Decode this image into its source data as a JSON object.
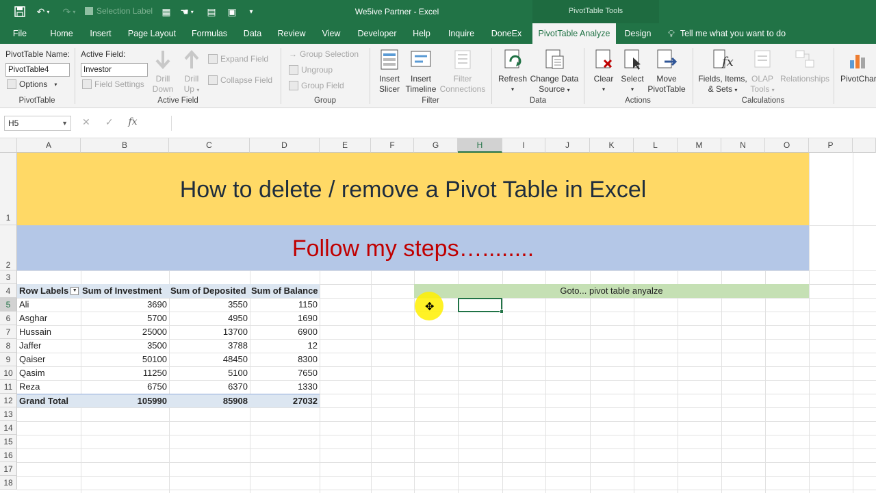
{
  "titlebar": {
    "selection_label": "Selection Label",
    "doc_title": "We5ive Partner  -  Excel",
    "tools_header": "PivotTable Tools"
  },
  "tabs": [
    {
      "label": "File",
      "active": false
    },
    {
      "label": "Home",
      "active": false
    },
    {
      "label": "Insert",
      "active": false
    },
    {
      "label": "Page Layout",
      "active": false
    },
    {
      "label": "Formulas",
      "active": false
    },
    {
      "label": "Data",
      "active": false
    },
    {
      "label": "Review",
      "active": false
    },
    {
      "label": "View",
      "active": false
    },
    {
      "label": "Developer",
      "active": false
    },
    {
      "label": "Help",
      "active": false
    },
    {
      "label": "Inquire",
      "active": false
    },
    {
      "label": "DoneEx",
      "active": false
    },
    {
      "label": "PivotTable Analyze",
      "active": true
    },
    {
      "label": "Design",
      "active": false
    }
  ],
  "tell_me": "Tell me what you want to do",
  "ribbon": {
    "pivottable": {
      "name_label": "PivotTable Name:",
      "name_value": "PivotTable4",
      "options": "Options",
      "group": "PivotTable"
    },
    "active_field": {
      "label": "Active Field:",
      "value": "Investor",
      "field_settings": "Field Settings",
      "drill_down": [
        "Drill",
        "Down"
      ],
      "drill_up": [
        "Drill",
        "Up"
      ],
      "expand_field": "Expand Field",
      "collapse_field": "Collapse Field",
      "group": "Active Field"
    },
    "group": {
      "group_selection": "Group Selection",
      "ungroup": "Ungroup",
      "group_field": "Group Field",
      "group": "Group"
    },
    "filter": {
      "insert_slicer": [
        "Insert",
        "Slicer"
      ],
      "insert_timeline": [
        "Insert",
        "Timeline"
      ],
      "filter_connections": [
        "Filter",
        "Connections"
      ],
      "group": "Filter"
    },
    "data": {
      "refresh": "Refresh",
      "change_data_source": [
        "Change Data",
        "Source"
      ],
      "group": "Data"
    },
    "actions": {
      "clear": "Clear",
      "select": "Select",
      "move_pivottable": [
        "Move",
        "PivotTable"
      ],
      "group": "Actions"
    },
    "calculations": {
      "fields_items_sets": [
        "Fields, Items,",
        "& Sets"
      ],
      "olap_tools": [
        "OLAP",
        "Tools"
      ],
      "relationships": "Relationships",
      "group": "Calculations"
    },
    "pivotchart": "PivotChart"
  },
  "formula_bar": {
    "name_box": "H5",
    "cancel": "✕",
    "enter": "✓",
    "fx": "fx",
    "content": ""
  },
  "columns": [
    "A",
    "B",
    "C",
    "D",
    "E",
    "F",
    "G",
    "H",
    "I",
    "J",
    "K",
    "L",
    "M",
    "N",
    "O",
    "P",
    "Q"
  ],
  "selected_column": "H",
  "rows": [
    "1",
    "2",
    "3",
    "4",
    "5",
    "6",
    "7",
    "8",
    "9",
    "10",
    "11",
    "12",
    "13",
    "14",
    "15",
    "16",
    "17",
    "18"
  ],
  "selected_row": "5",
  "sheet": {
    "banner_title": "How to delete / remove a Pivot Table in Excel",
    "banner_subtitle": "Follow my steps…........",
    "goto_note": "Goto... pivot table anyalze"
  },
  "pivot": {
    "headers": [
      "Row Labels",
      "Sum of Investment",
      "Sum of Deposited",
      "Sum of Balance"
    ],
    "rows": [
      [
        "Ali",
        "3690",
        "3550",
        "1150"
      ],
      [
        "Asghar",
        "5700",
        "4950",
        "1690"
      ],
      [
        "Hussain",
        "25000",
        "13700",
        "6900"
      ],
      [
        "Jaffer",
        "3500",
        "3788",
        "12"
      ],
      [
        "Qaiser",
        "50100",
        "48450",
        "8300"
      ],
      [
        "Qasim",
        "11250",
        "5100",
        "7650"
      ],
      [
        "Reza",
        "6750",
        "6370",
        "1330"
      ]
    ],
    "total": [
      "Grand Total",
      "105990",
      "85908",
      "27032"
    ]
  }
}
